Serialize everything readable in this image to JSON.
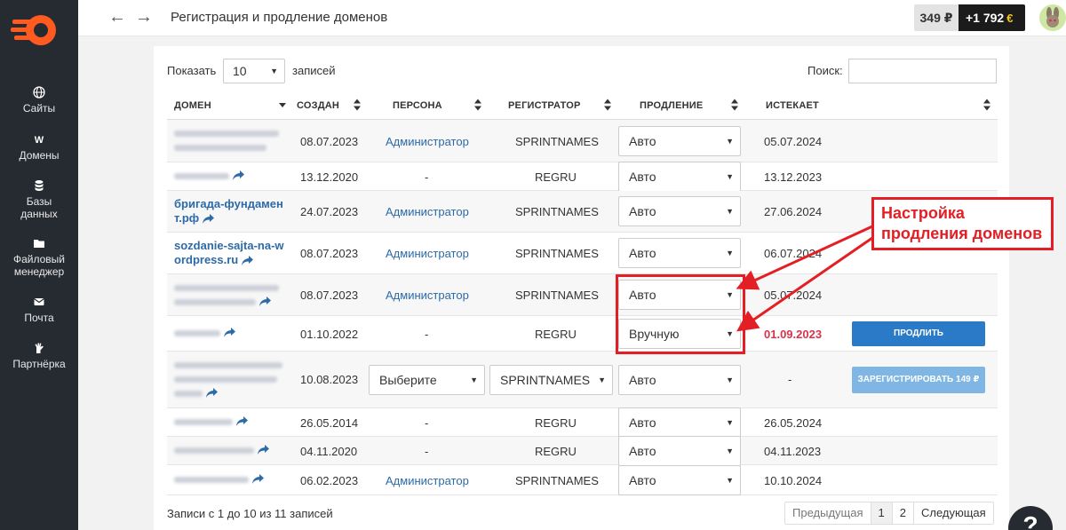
{
  "header": {
    "title": "Регистрация и продление доменов",
    "balance": "349 ₽",
    "bonus": "+1 792",
    "back_icon": "arrow-left-icon",
    "forward_icon": "arrow-right-icon"
  },
  "sidebar": {
    "items": [
      {
        "label": "Сайты",
        "icon": "globe-icon"
      },
      {
        "label": "Домены",
        "icon": "w-icon"
      },
      {
        "label": "Базы данных",
        "icon": "database-icon"
      },
      {
        "label": "Файловый менеджер",
        "icon": "folder-icon"
      },
      {
        "label": "Почта",
        "icon": "mail-icon"
      },
      {
        "label": "Партнёрка",
        "icon": "hand-icon"
      }
    ]
  },
  "table_controls": {
    "show_label": "Показать",
    "show_value": "10",
    "records_label": "записей",
    "search_label": "Поиск:"
  },
  "columns": [
    "ДОМЕН",
    "СОЗДАН",
    "ПЕРСОНА",
    "РЕГИСТРАТОР",
    "ПРОДЛЕНИЕ",
    "ИСТЕКАЕТ"
  ],
  "rows": [
    {
      "domain": "",
      "created": "08.07.2023",
      "persona": "Администратор",
      "registrar": "SPRINTNAMES",
      "renewal": "Авто",
      "expires": "05.07.2024"
    },
    {
      "domain": "",
      "created": "13.12.2020",
      "persona": "-",
      "registrar": "REGRU",
      "renewal": "Авто",
      "expires": "13.12.2023"
    },
    {
      "domain": "бригада-фундамент.рф",
      "domain_l1": "бригада-фундамен",
      "domain_l2": "т.рф",
      "created": "24.07.2023",
      "persona": "Администратор",
      "registrar": "SPRINTNAMES",
      "renewal": "Авто",
      "expires": "27.06.2024"
    },
    {
      "domain": "sozdanie-sajta-na-wordpress.ru",
      "domain_l1": "sozdanie-sajta-na-w",
      "domain_l2": "ordpress.ru",
      "created": "08.07.2023",
      "persona": "Администратор",
      "registrar": "SPRINTNAMES",
      "renewal": "Авто",
      "expires": "06.07.2024"
    },
    {
      "domain": "",
      "created": "08.07.2023",
      "persona": "Администратор",
      "registrar": "SPRINTNAMES",
      "renewal": "Авто",
      "expires": "05.07.2024"
    },
    {
      "domain": "",
      "created": "01.10.2022",
      "persona": "-",
      "registrar": "REGRU",
      "renewal": "Вручную",
      "expires": "01.09.2023",
      "action": "ПРОДЛИТЬ"
    },
    {
      "domain": "",
      "created": "10.08.2023",
      "persona": "Выберите",
      "registrar": "SPRINTNAMES",
      "renewal": "Авто",
      "expires": "-",
      "action": "ЗАРЕГИСТРИРОВАТЬ 149 ₽"
    },
    {
      "domain": "",
      "created": "26.05.2014",
      "persona": "-",
      "registrar": "REGRU",
      "renewal": "Авто",
      "expires": "26.05.2024"
    },
    {
      "domain": "",
      "created": "04.11.2020",
      "persona": "-",
      "registrar": "REGRU",
      "renewal": "Авто",
      "expires": "04.11.2023"
    },
    {
      "domain": "",
      "created": "06.02.2023",
      "persona": "Администратор",
      "registrar": "SPRINTNAMES",
      "renewal": "Авто",
      "expires": "10.10.2024"
    }
  ],
  "footer": {
    "info": "Записи с 1 до 10 из 11 записей",
    "prev": "Предыдущая",
    "page1": "1",
    "page2": "2",
    "next": "Следующая"
  },
  "annotation": {
    "line1": "Настройка",
    "line2": "продления доменов",
    "color": "#e31e24"
  },
  "help": "?"
}
